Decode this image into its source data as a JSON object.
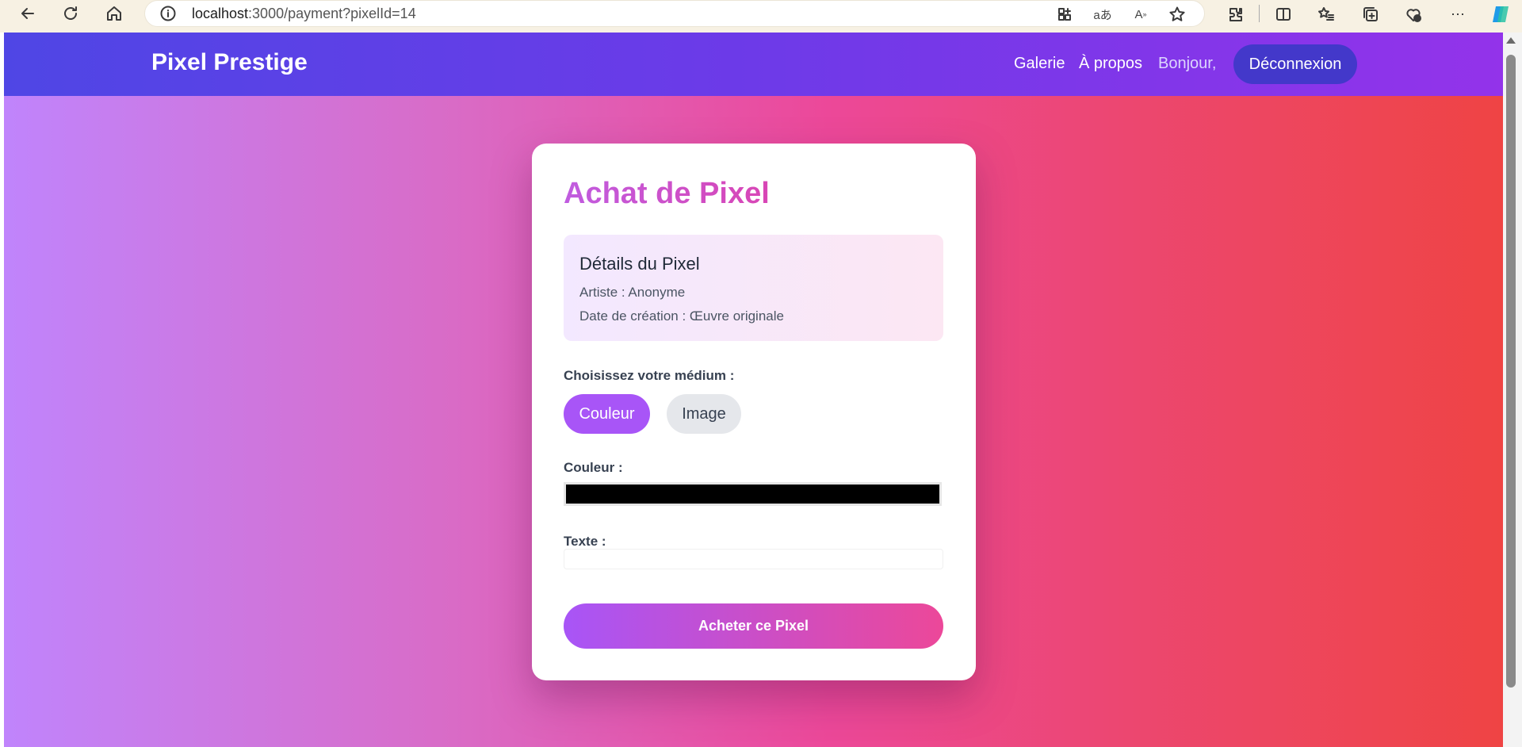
{
  "browser": {
    "url_host": "localhost",
    "url_path": ":3000/payment?pixelId=14",
    "icons": [
      "back-icon",
      "refresh-icon",
      "home-icon",
      "info-icon",
      "app-icon",
      "translate-icon",
      "read-aloud-icon",
      "favorite-star-icon",
      "extensions-icon",
      "split-screen-icon",
      "favorites-icon",
      "collections-icon",
      "health-icon",
      "more-icon",
      "copilot-icon"
    ]
  },
  "navbar": {
    "brand": "Pixel Prestige",
    "links": [
      "Galerie",
      "À propos"
    ],
    "greeting": "Bonjour,",
    "logout_label": "Déconnexion"
  },
  "card": {
    "title": "Achat de Pixel",
    "details": {
      "heading": "Détails du Pixel",
      "artist": "Artiste : Anonyme",
      "date": "Date de création : Œuvre originale"
    },
    "medium_label": "Choisissez votre médium :",
    "medium_options": [
      "Couleur",
      "Image"
    ],
    "selected_medium": "Couleur",
    "color_label": "Couleur :",
    "color_value": "#000000",
    "text_label": "Texte :",
    "text_value": "",
    "buy_label": "Acheter ce Pixel"
  },
  "colors": {
    "accent_purple": "#a855f7",
    "accent_pink": "#ec4899",
    "navbar_start": "#4f46e5",
    "navbar_end": "#9333ea",
    "logout_bg": "#4338ca"
  }
}
